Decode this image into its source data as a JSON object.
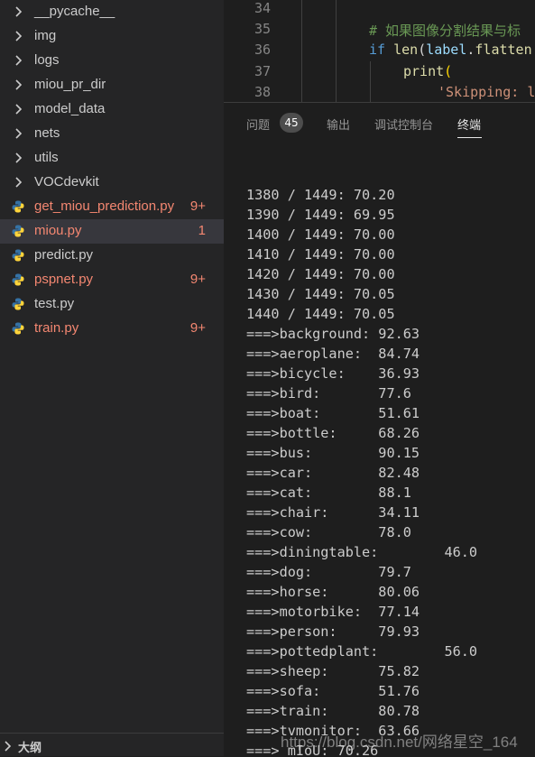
{
  "sidebar": {
    "items": [
      {
        "label": "__pycache__",
        "kind": "folder",
        "icon": "chevron-right-icon",
        "status": "",
        "badge": ""
      },
      {
        "label": "img",
        "kind": "folder",
        "icon": "chevron-right-icon",
        "status": "",
        "badge": ""
      },
      {
        "label": "logs",
        "kind": "folder",
        "icon": "chevron-right-icon",
        "status": "",
        "badge": ""
      },
      {
        "label": "miou_pr_dir",
        "kind": "folder",
        "icon": "chevron-right-icon",
        "status": "",
        "badge": ""
      },
      {
        "label": "model_data",
        "kind": "folder",
        "icon": "chevron-right-icon",
        "status": "",
        "badge": ""
      },
      {
        "label": "nets",
        "kind": "folder",
        "icon": "chevron-right-icon",
        "status": "",
        "badge": ""
      },
      {
        "label": "utils",
        "kind": "folder",
        "icon": "chevron-right-icon",
        "status": "",
        "badge": ""
      },
      {
        "label": "VOCdevkit",
        "kind": "folder",
        "icon": "chevron-right-icon",
        "status": "",
        "badge": ""
      },
      {
        "label": "get_miou_prediction.py",
        "kind": "file",
        "icon": "python-icon",
        "status": "error",
        "badge": "9+"
      },
      {
        "label": "miou.py",
        "kind": "file",
        "icon": "python-icon",
        "status": "error",
        "badge": "1",
        "active": true
      },
      {
        "label": "predict.py",
        "kind": "file",
        "icon": "python-icon",
        "status": "",
        "badge": ""
      },
      {
        "label": "pspnet.py",
        "kind": "file",
        "icon": "python-icon",
        "status": "error",
        "badge": "9+"
      },
      {
        "label": "test.py",
        "kind": "file",
        "icon": "python-icon",
        "status": "",
        "badge": ""
      },
      {
        "label": "train.py",
        "kind": "file",
        "icon": "python-icon",
        "status": "error",
        "badge": "9+"
      }
    ],
    "outline_label": "大纲"
  },
  "editor": {
    "lines": [
      {
        "num": "34",
        "code": ""
      },
      {
        "num": "35",
        "code": "# 如果图像分割结果与标"
      },
      {
        "num": "36",
        "code": "if len(label.flatten"
      },
      {
        "num": "37",
        "code": "print("
      },
      {
        "num": "38",
        "code": "'Skipping: l"
      }
    ]
  },
  "panel": {
    "tabs": [
      {
        "label": "问题",
        "active": false
      },
      {
        "label": "输出",
        "active": false
      },
      {
        "label": "调试控制台",
        "active": false
      },
      {
        "label": "终端",
        "active": true
      }
    ],
    "problems_count": "45"
  },
  "terminal": {
    "lines": [
      "1380 / 1449: 70.20",
      "1390 / 1449: 69.95",
      "1400 / 1449: 70.00",
      "1410 / 1449: 70.00",
      "1420 / 1449: 70.00",
      "1430 / 1449: 70.05",
      "1440 / 1449: 70.05",
      "===>background:\t92.63",
      "===>aeroplane:\t84.74",
      "===>bicycle:\t36.93",
      "===>bird:\t77.6",
      "===>boat:\t51.61",
      "===>bottle:\t68.26",
      "===>bus:\t90.15",
      "===>car:\t82.48",
      "===>cat:\t88.1",
      "===>chair:\t34.11",
      "===>cow:\t78.0",
      "===>diningtable:\t46.0",
      "===>dog:\t79.7",
      "===>horse:\t80.06",
      "===>motorbike:\t77.14",
      "===>person:\t79.93",
      "===>pottedplant:\t56.0",
      "===>sheep:\t75.82",
      "===>sofa:\t51.76",
      "===>train:\t80.78",
      "===>tvmonitor:\t63.66",
      "===> mIoU: 70.26"
    ]
  },
  "watermark": "https://blog.csdn.net/网络星空_164",
  "colors": {
    "error": "#f48771",
    "sidebar_bg": "#252526",
    "editor_bg": "#1e1e1e",
    "keyword": "#569cd6",
    "comment": "#6a9955",
    "string": "#ce9178",
    "function": "#dcdcaa",
    "python_blue": "#3572a5",
    "python_yellow": "#ffd43b"
  }
}
